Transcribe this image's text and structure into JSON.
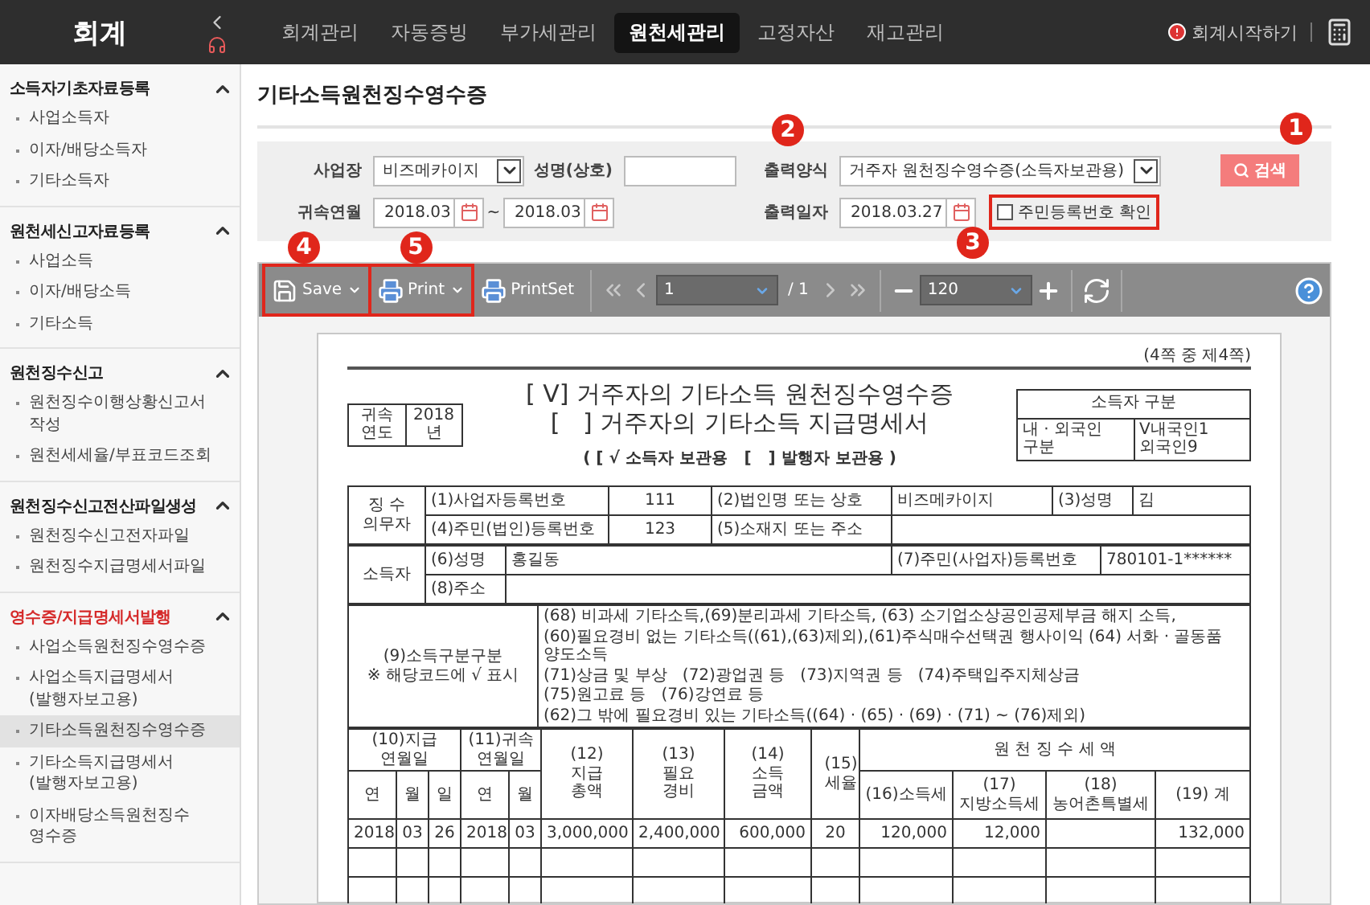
{
  "app": {
    "title": "회계"
  },
  "nav": [
    {
      "label": "회계관리",
      "selected": false
    },
    {
      "label": "자동증빙",
      "selected": false
    },
    {
      "label": "부가세관리",
      "selected": false
    },
    {
      "label": "원천세관리",
      "selected": true
    },
    {
      "label": "고정자산",
      "selected": false
    },
    {
      "label": "재고관리",
      "selected": false
    }
  ],
  "start_link": "회계시작하기",
  "sidebar": [
    {
      "title": "소득자기초자료등록",
      "expanded": true,
      "selected": false,
      "items": [
        {
          "label": "사업소득자",
          "selected": false
        },
        {
          "label": "이자/배당소득자",
          "selected": false
        },
        {
          "label": "기타소득자",
          "selected": false
        }
      ]
    },
    {
      "title": "원천세신고자료등록",
      "expanded": true,
      "selected": false,
      "items": [
        {
          "label": "사업소득",
          "selected": false
        },
        {
          "label": "이자/배당소득",
          "selected": false
        },
        {
          "label": "기타소득",
          "selected": false
        }
      ]
    },
    {
      "title": "원천징수신고",
      "expanded": true,
      "selected": false,
      "items": [
        {
          "label": "원천징수이행상황신고서 작성",
          "selected": false
        },
        {
          "label": "원천세세율/부표코드조회",
          "selected": false
        }
      ]
    },
    {
      "title": "원천징수신고전산파일생성",
      "expanded": true,
      "selected": false,
      "items": [
        {
          "label": "원천징수신고전자파일",
          "selected": false
        },
        {
          "label": "원천징수지급명세서파일",
          "selected": false
        }
      ]
    },
    {
      "title": "영수증/지급명세서발행",
      "expanded": true,
      "selected": true,
      "items": [
        {
          "label": "사업소득원천징수영수증",
          "selected": false
        },
        {
          "label": "사업소득지급명세서 (발행자보고용)",
          "selected": false
        },
        {
          "label": "기타소득원천징수영수증",
          "selected": true
        },
        {
          "label": "기타소득지급명세서 (발행자보고용)",
          "selected": false
        },
        {
          "label": "이자배당소득원천징수 영수증",
          "selected": false
        }
      ]
    }
  ],
  "page_title": "기타소득원천징수영수증",
  "filters": {
    "workplace": {
      "label": "사업장",
      "value": "비즈메카이지"
    },
    "name": {
      "label": "성명(상호)"
    },
    "period": {
      "label": "귀속연월",
      "from": "2018.03",
      "separator": "~",
      "to": "2018.03"
    },
    "format": {
      "label": "출력양식",
      "value": "거주자 원천징수영수증(소득자보관용)",
      "callout": "2"
    },
    "date": {
      "label": "출력일자",
      "value": "2018.03.27"
    },
    "id_check": {
      "label": "주민등록번호 확인",
      "checked": false,
      "highlighted": true,
      "callout": "3"
    },
    "search": {
      "label": "검색",
      "callout": "1"
    }
  },
  "viewer": {
    "save": {
      "label": "Save",
      "highlighted": true,
      "callout": "4"
    },
    "print": {
      "label": "Print",
      "highlighted": true,
      "callout": "5"
    },
    "print_set": {
      "label": "PrintSet"
    },
    "page": "1",
    "page_total": "/ 1",
    "zoom": "120"
  },
  "document": {
    "page_info": "(4쪽 중 제4쪽)",
    "year_label": "귀속 연도",
    "year_value": "2018 년",
    "titles": [
      "[ V] 거주자의 기타소득 원천징수영수증",
      "[   ] 거주자의 기타소득 지급명세서"
    ],
    "copy_line": "( [ √ 소득자 보관용   [   ] 발행자 보관용 )",
    "earner_type": {
      "title": "소득자 구분",
      "label": "내 · 외국인 구분",
      "value": "V내국인1",
      "value_2": "외국인9"
    },
    "payer": {
      "heading": "징 수 의무자",
      "reg_no_label": "(1)사업자등록번호",
      "reg_no": "111",
      "company_label": "(2)법인명 또는 상호",
      "company": "비즈메카이지",
      "name_label": "(3)성명",
      "name": "김",
      "id_label": "(4)주민(법인)등록번호",
      "id": "123",
      "address_label": "(5)소재지 또는 주소"
    },
    "earner": {
      "heading": "소득자",
      "name_label": "(6)성명",
      "name": "홍길동",
      "id_label": "(7)주민(사업자)등록번호",
      "id": "780101-1******",
      "address_label": "(8)주소"
    },
    "code": {
      "label": "(9)소득구분구분",
      "note": "※ 해당코드에 √ 표시",
      "lines": [
        "(68) 비과세 기타소득,(69)분리과세 기타소득, (63) 소기업소상공인공제부금 해지 소득,",
        "(60)필요경비 없는 기타소득((61),(63)제외),(61)주식매수선택권 행사이익 (64) 서화 · 골동품 양도소득",
        "(71)상금 및 부상   (72)광업권 등   (73)지역권 등   (74)주택입주지체상금",
        "(75)원고료 등   (76)강연료 등",
        "(62)그 밖에 필요경비 있는 기타소득((64) · (65) · (69) · (71) ~ (76)제외)"
      ]
    },
    "table": {
      "group_headers": [
        "(10)지급 연월일",
        "(11)귀속 연월일",
        "(12) 지급 총액",
        "(13) 필요 경비",
        "(14) 소득 금액",
        "(15) 세율",
        "원 천 징 수 세 액"
      ],
      "sub_headers": [
        "연",
        "월",
        "일",
        "연",
        "월",
        "(16)소득세",
        "(17) 지방소득세",
        "(18) 농어촌특별세",
        "(19) 계"
      ],
      "rows": [
        [
          "2018",
          "03",
          "26",
          "2018",
          "03",
          "3,000,000",
          "2,400,000",
          "600,000",
          "20",
          "120,000",
          "12,000",
          null,
          "132,000"
        ]
      ]
    }
  }
}
